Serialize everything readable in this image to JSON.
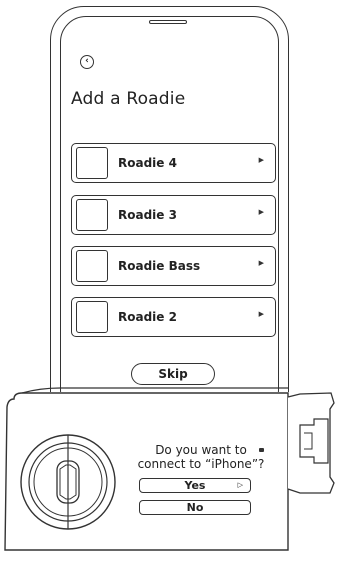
{
  "phone_screen": {
    "back_icon": "chevron-left-icon",
    "title": "Add a Roadie",
    "devices": [
      {
        "label": "Roadie 4"
      },
      {
        "label": "Roadie 3"
      },
      {
        "label": "Roadie Bass"
      },
      {
        "label": "Roadie 2"
      }
    ],
    "arrow_icon": "caret-right-icon",
    "skip_label": "Skip"
  },
  "device_dialog": {
    "question_line1": "Do you want to",
    "question_line2": "connect to “iPhone”?",
    "yes_label": "Yes",
    "no_label": "No",
    "bluetooth_icon": "bluetooth-led-icon"
  }
}
